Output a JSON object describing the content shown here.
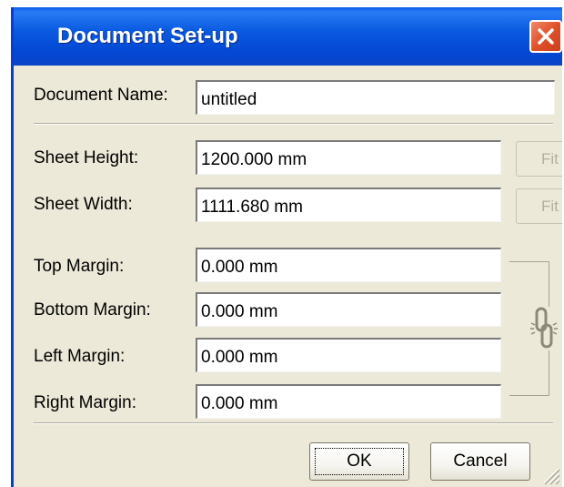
{
  "window": {
    "title": "Document Set-up"
  },
  "fields": {
    "document_name": {
      "label": "Document Name:",
      "value": "untitled"
    },
    "sheet_height": {
      "label": "Sheet Height:",
      "value": "1200.000 mm"
    },
    "sheet_width": {
      "label": "Sheet Width:",
      "value": "1111.680 mm"
    },
    "top_margin": {
      "label": "Top Margin:",
      "value": "0.000 mm"
    },
    "bottom_margin": {
      "label": "Bottom Margin:",
      "value": "0.000 mm"
    },
    "left_margin": {
      "label": "Left Margin:",
      "value": "0.000 mm"
    },
    "right_margin": {
      "label": "Right Margin:",
      "value": "0.000 mm"
    }
  },
  "fit_buttons": {
    "height_label": "Fit",
    "width_label": "Fit"
  },
  "buttons": {
    "ok_label": "OK",
    "cancel_label": "Cancel"
  },
  "icons": {
    "close": "close-icon",
    "link": "chain-link-icon",
    "grip": "resize-grip-icon"
  },
  "colors": {
    "titlebar": "#0a5ae0",
    "close_button": "#e0502a",
    "dialog_bg": "#ece9d8"
  }
}
